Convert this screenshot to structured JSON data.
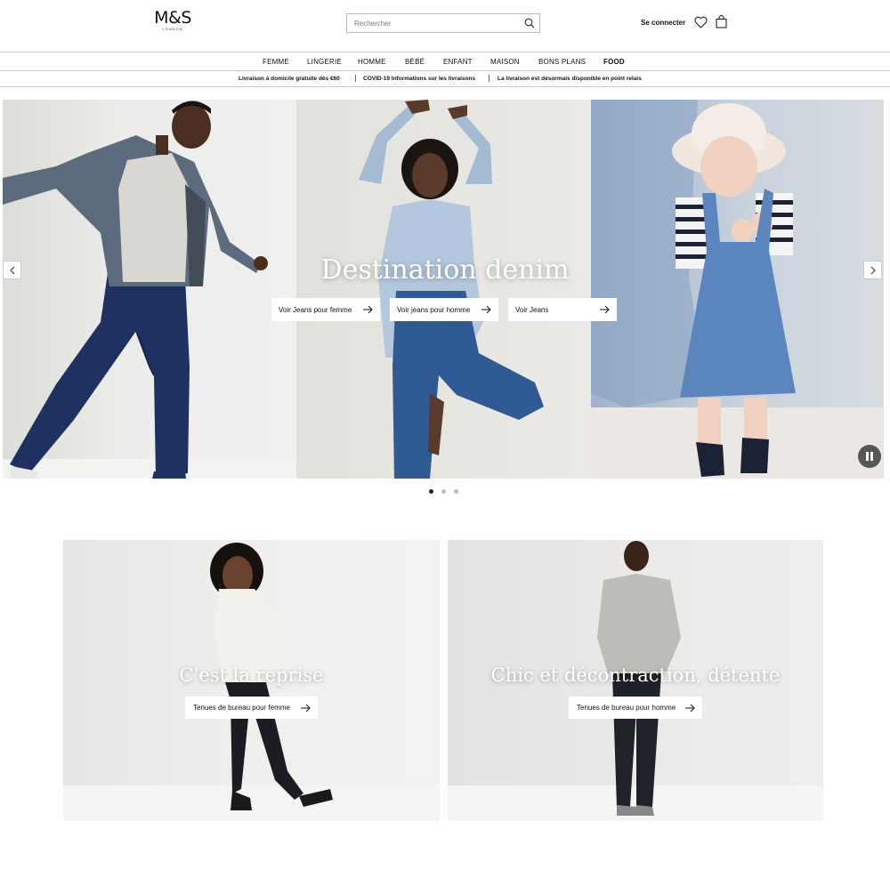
{
  "brand": {
    "name": "M&S",
    "sub": "LONDON"
  },
  "search": {
    "placeholder": "Rechercher"
  },
  "account": {
    "signin_label": "Se connecter"
  },
  "nav": {
    "items": [
      "FEMME",
      "LINGERIE",
      "HOMME",
      "BÉBÉ",
      "ENFANT",
      "MAISON",
      "BONS PLANS",
      "FOOD"
    ]
  },
  "promo": {
    "items": [
      "Livraison à domicile gratuite dès €60",
      "COVID-19 Informations sur les livraisons",
      "La livraison est désormais disponible en point relais"
    ]
  },
  "hero": {
    "title": "Destination denim",
    "ctas": [
      "Voir Jeans pour femme",
      "Voir jeans pour homme",
      "Voir Jeans"
    ],
    "slide_count": 3,
    "active_slide": 1
  },
  "tiles": [
    {
      "title": "C'est la reprise",
      "cta": "Tenues de bureau pour femme"
    },
    {
      "title": "Chic et décontraction, détente",
      "cta": "Tenues de bureau pour homme"
    }
  ],
  "colors": {
    "text": "#111111",
    "border": "#cccccc",
    "white": "#ffffff"
  }
}
